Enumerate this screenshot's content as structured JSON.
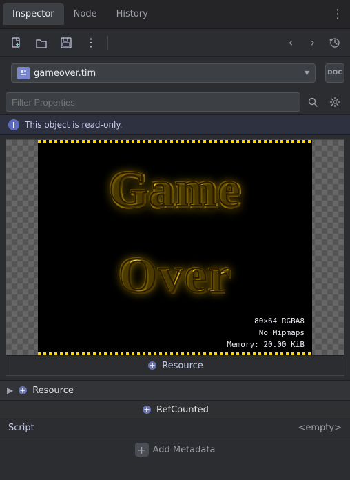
{
  "tabs": [
    {
      "id": "inspector",
      "label": "Inspector",
      "active": true
    },
    {
      "id": "node",
      "label": "Node",
      "active": false
    },
    {
      "id": "history",
      "label": "History",
      "active": false
    }
  ],
  "toolbar": {
    "new_icon": "📄",
    "open_icon": "📂",
    "save_icon": "💾",
    "menu_icon": "⋮",
    "back_label": "‹",
    "forward_label": "›",
    "object_label": "⟳"
  },
  "file_selector": {
    "filename": "gameover.tim",
    "chevron": "▾",
    "doc_label": "DOC"
  },
  "filter": {
    "placeholder": "Filter Properties"
  },
  "info_bar": {
    "message": "This object is read-only."
  },
  "image_overlay": {
    "dimensions": "80×64 RGBA8",
    "mipmaps": "No Mipmaps",
    "memory": "Memory: 20.00 KiB"
  },
  "resource_section": {
    "title": "Resource",
    "icon": "resource"
  },
  "refcounted_section": {
    "title": "RefCounted",
    "icon": "refcounted"
  },
  "properties": [
    {
      "label": "Script",
      "value": "<empty>"
    }
  ],
  "add_metadata": {
    "label": "Add Metadata"
  }
}
